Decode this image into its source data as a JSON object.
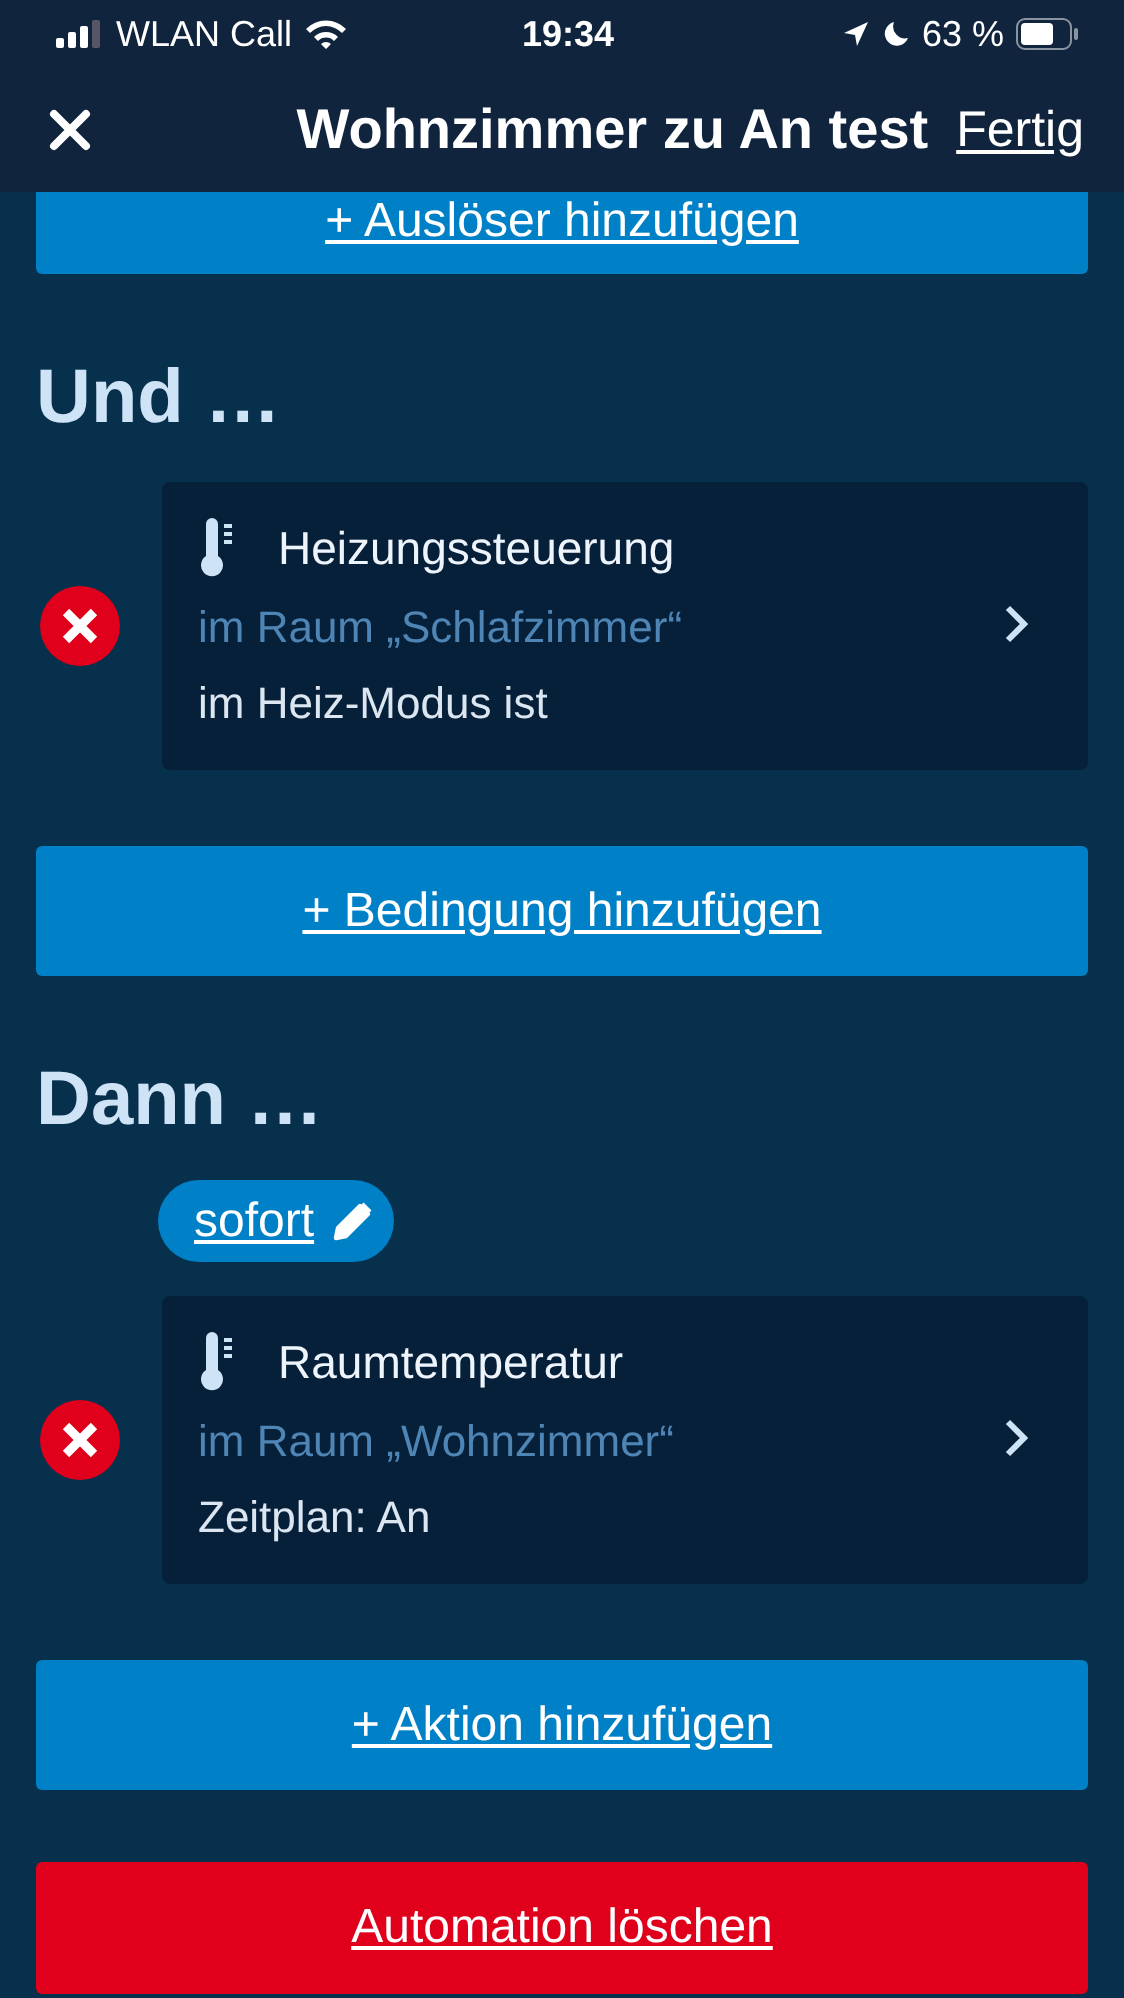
{
  "status_bar": {
    "carrier": "WLAN Call",
    "time": "19:34",
    "battery": "63 %"
  },
  "header": {
    "title": "Wohnzimmer zu An test",
    "done": "Fertig"
  },
  "trigger_add_button": "+ Auslöser hinzufügen",
  "conditions": {
    "heading": "Und …",
    "items": [
      {
        "title": "Heizungssteuerung",
        "room": "im Raum „Schlafzimmer“",
        "state": "im Heiz-Modus ist"
      }
    ],
    "add_button": "+ Bedingung hinzufügen"
  },
  "actions": {
    "heading": "Dann …",
    "delay": "sofort",
    "items": [
      {
        "title": "Raumtemperatur",
        "room": "im Raum „Wohnzimmer“",
        "state": "Zeitplan: An"
      }
    ],
    "add_button": "+ Aktion hinzufügen"
  },
  "delete_button": "Automation löschen"
}
